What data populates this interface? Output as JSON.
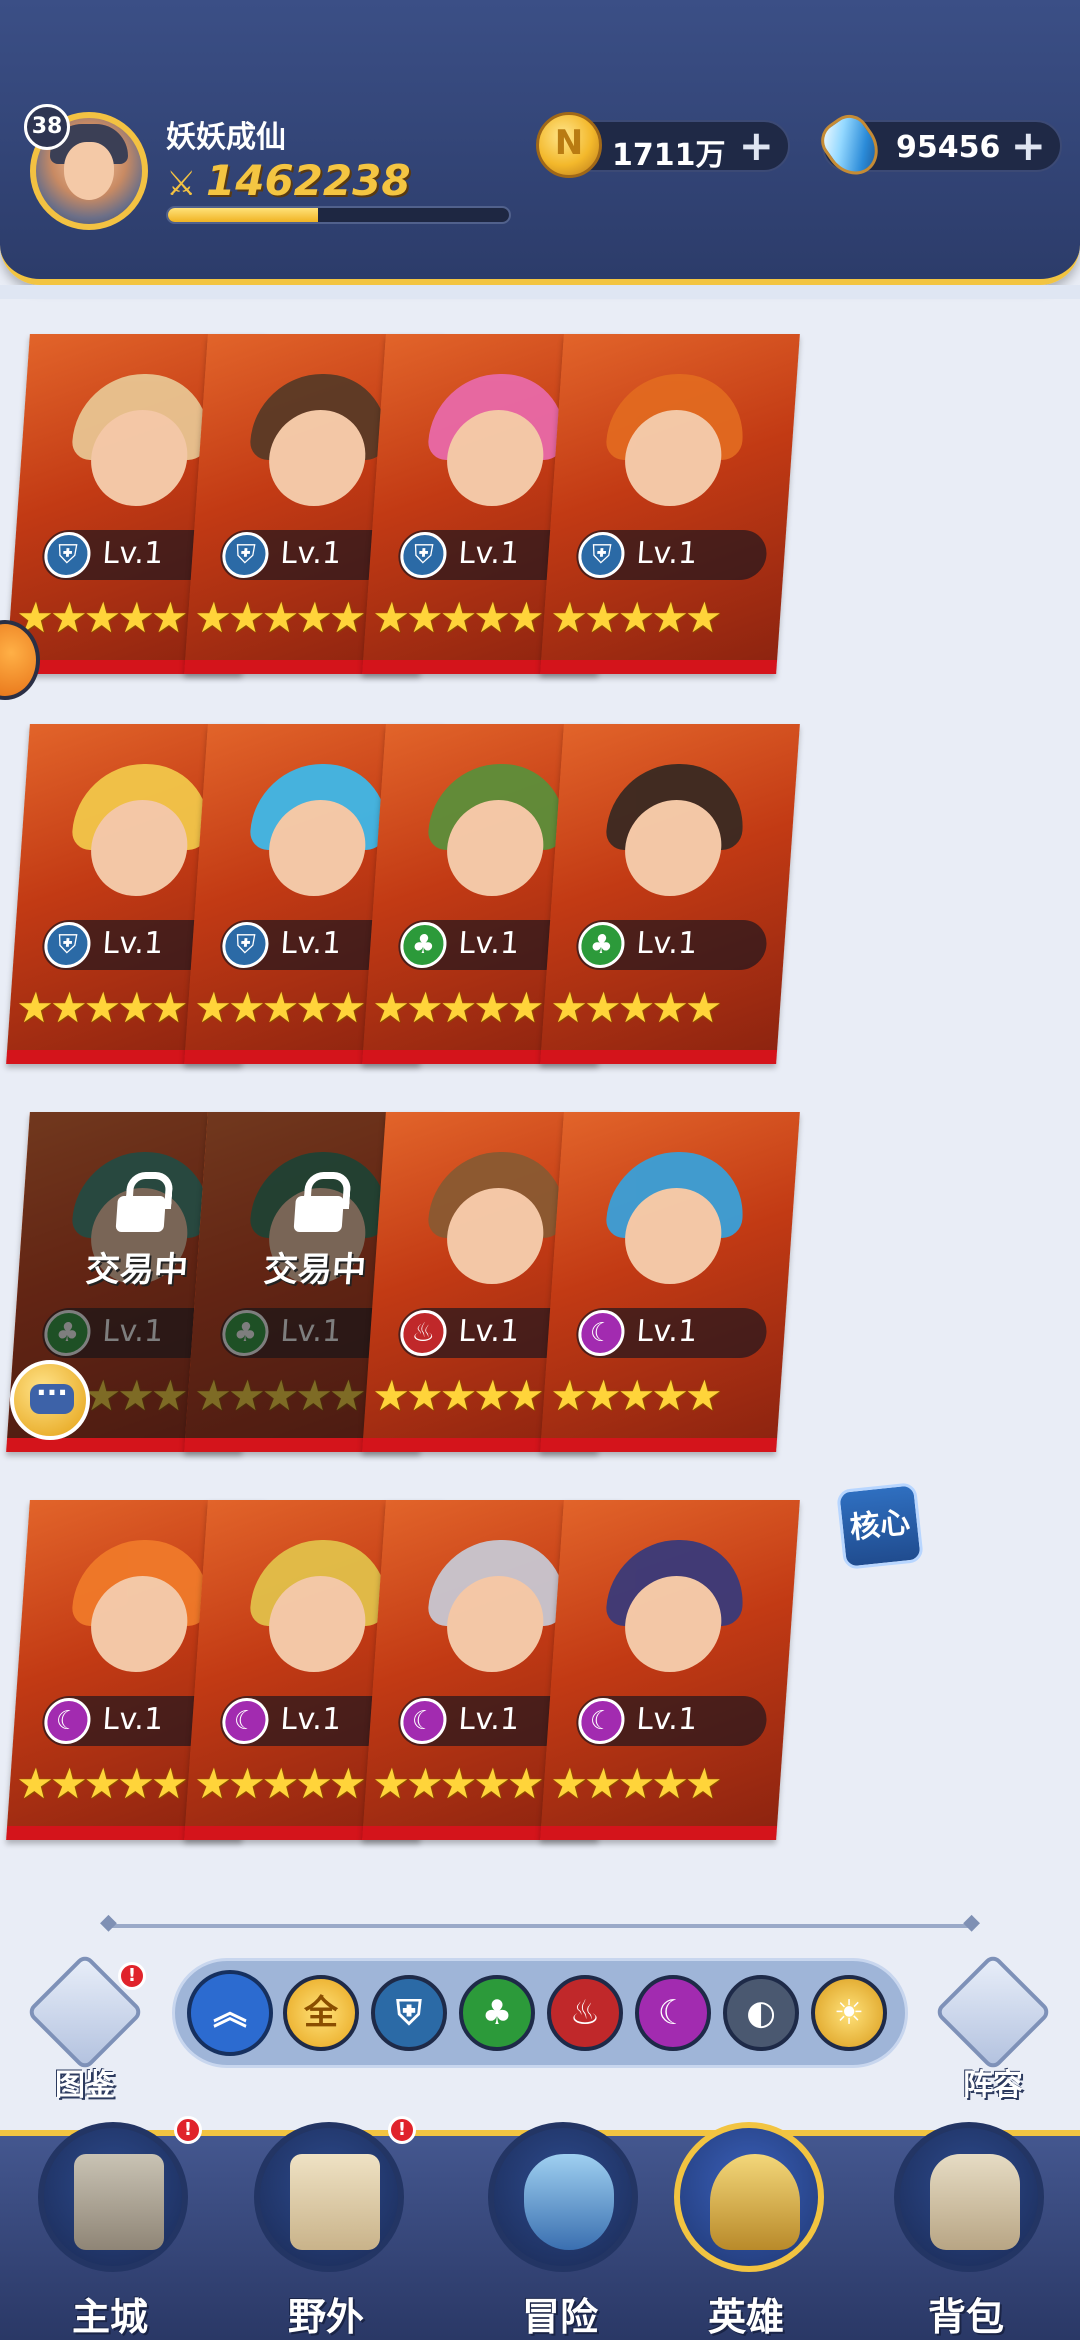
{
  "header": {
    "player_level": "38",
    "player_name": "妖妖成仙",
    "power": "1462238",
    "xp_progress": 0.44,
    "gold": "1711万",
    "potion": "95456",
    "plus": "+"
  },
  "colors": {
    "accent_gold": "#f2c441",
    "card_bottom": "#d4141b",
    "header_bg": "#3b4f86"
  },
  "heroes": [
    {
      "level": "Lv.1",
      "stars": "★★★★★",
      "faction": "guard",
      "hair": "#e8c592",
      "locked": false
    },
    {
      "level": "Lv.1",
      "stars": "★★★★★",
      "faction": "guard",
      "hair": "#5a3a26",
      "locked": false
    },
    {
      "level": "Lv.1",
      "stars": "★★★★★",
      "faction": "guard",
      "hair": "#e86aa8",
      "locked": false
    },
    {
      "level": "Lv.1",
      "stars": "★★★★★",
      "faction": "guard",
      "hair": "#e26a20",
      "locked": false
    },
    {
      "level": "Lv.1",
      "stars": "★★★★★",
      "faction": "guard",
      "hair": "#f2c74a",
      "locked": false
    },
    {
      "level": "Lv.1",
      "stars": "★★★★★",
      "faction": "guard",
      "hair": "#3fb8e8",
      "locked": false
    },
    {
      "level": "Lv.1",
      "stars": "★★★★★",
      "faction": "nature",
      "hair": "#5c8f3a",
      "locked": false
    },
    {
      "level": "Lv.1",
      "stars": "★★★★★",
      "faction": "nature",
      "hair": "#3a2a22",
      "locked": false
    },
    {
      "level": "Lv.1",
      "stars": "★★★★★",
      "faction": "nature",
      "hair": "#3a8c7a",
      "locked": true,
      "lock_text": "交易中"
    },
    {
      "level": "Lv.1",
      "stars": "★★★★★",
      "faction": "nature",
      "hair": "#2f7a5a",
      "locked": true,
      "lock_text": "交易中"
    },
    {
      "level": "Lv.1",
      "stars": "★★★★★",
      "faction": "fire",
      "hair": "#8a5a32",
      "locked": false
    },
    {
      "level": "Lv.1",
      "stars": "★★★★★",
      "faction": "dark",
      "hair": "#3aa0d8",
      "locked": false
    },
    {
      "level": "Lv.1",
      "stars": "★★★★★",
      "faction": "dark",
      "hair": "#f07a2a",
      "locked": false
    },
    {
      "level": "Lv.1",
      "stars": "★★★★★",
      "faction": "dark",
      "hair": "#e2c04a",
      "locked": false
    },
    {
      "level": "Lv.1",
      "stars": "★★★★★",
      "faction": "dark",
      "hair": "#c8c8d2",
      "locked": false
    },
    {
      "level": "Lv.1",
      "stars": "★★★★★",
      "faction": "dark",
      "hair": "#3a3a7a",
      "locked": false
    }
  ],
  "core_tag": "核心",
  "codex": {
    "label": "图鉴",
    "badge": "!"
  },
  "lineup": {
    "label": "阵容"
  },
  "filters": {
    "all": "全",
    "up": "︽"
  },
  "nav": [
    {
      "label": "主城",
      "badge": "!"
    },
    {
      "label": "野外",
      "badge": "!"
    },
    {
      "label": "冒险"
    },
    {
      "label": "英雄"
    },
    {
      "label": "背包"
    }
  ]
}
